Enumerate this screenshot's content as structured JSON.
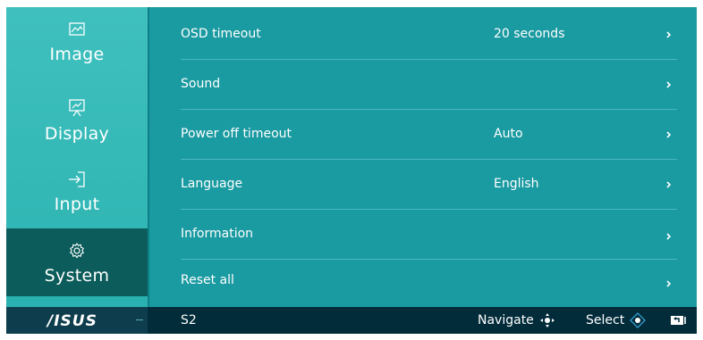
{
  "brand": {
    "logo_text": "/ISUS"
  },
  "sidebar": {
    "items": [
      {
        "label": "Image",
        "icon": "image-icon",
        "active": false
      },
      {
        "label": "Display",
        "icon": "display-icon",
        "active": false
      },
      {
        "label": "Input",
        "icon": "input-icon",
        "active": false
      },
      {
        "label": "System",
        "icon": "system-gear-icon",
        "active": true
      }
    ]
  },
  "settings": {
    "rows": [
      {
        "label": "OSD timeout",
        "value": "20 seconds"
      },
      {
        "label": "Sound",
        "value": ""
      },
      {
        "label": "Power off timeout",
        "value": "Auto"
      },
      {
        "label": "Language",
        "value": "English"
      },
      {
        "label": "Information",
        "value": ""
      },
      {
        "label": "Reset all",
        "value": ""
      }
    ]
  },
  "footer": {
    "model": "S2",
    "navigate_label": "Navigate",
    "select_label": "Select"
  },
  "colors": {
    "panel": "#1a9aa1",
    "sidebar": "#3fc0be",
    "sidebar_active": "#0b5c5a",
    "footer": "#022c3a"
  }
}
